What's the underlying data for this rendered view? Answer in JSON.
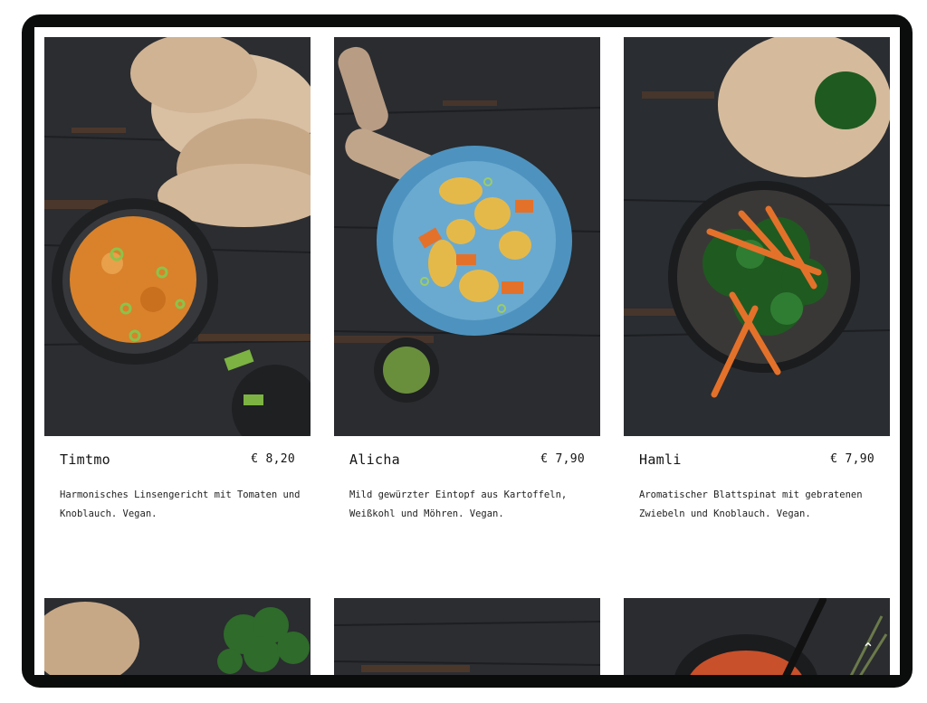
{
  "dishes": [
    {
      "name": "Timtmo",
      "price": "€ 8,20",
      "description": "Harmonisches Linsengericht mit Tomaten und Knoblauch. Vegan.",
      "image": "timtmo-photo"
    },
    {
      "name": "Alicha",
      "price": "€ 7,90",
      "description": "Mild gewürzter Eintopf aus Kartoffeln, Weißkohl und Möhren. Vegan.",
      "image": "alicha-photo"
    },
    {
      "name": "Hamli",
      "price": "€ 7,90",
      "description": "Aromatischer Blattspinat mit gebratenen Zwiebeln und Knoblauch. Vegan.",
      "image": "hamli-photo"
    }
  ],
  "next_row_images": [
    "injera-parsley-photo",
    "dark-wood-photo",
    "tomato-soup-photo"
  ],
  "scroll_top": {
    "icon": "chevron-up-icon",
    "glyph": "⌃"
  },
  "colors": {
    "frame": "#0a0d0c",
    "wood": "#2a2c30",
    "injera": "#c9ab8c",
    "lentil": "#d9822b",
    "carrot": "#e4712a",
    "potato": "#e5b949",
    "plate": "#4e93bf",
    "spinach": "#1f5a21"
  }
}
